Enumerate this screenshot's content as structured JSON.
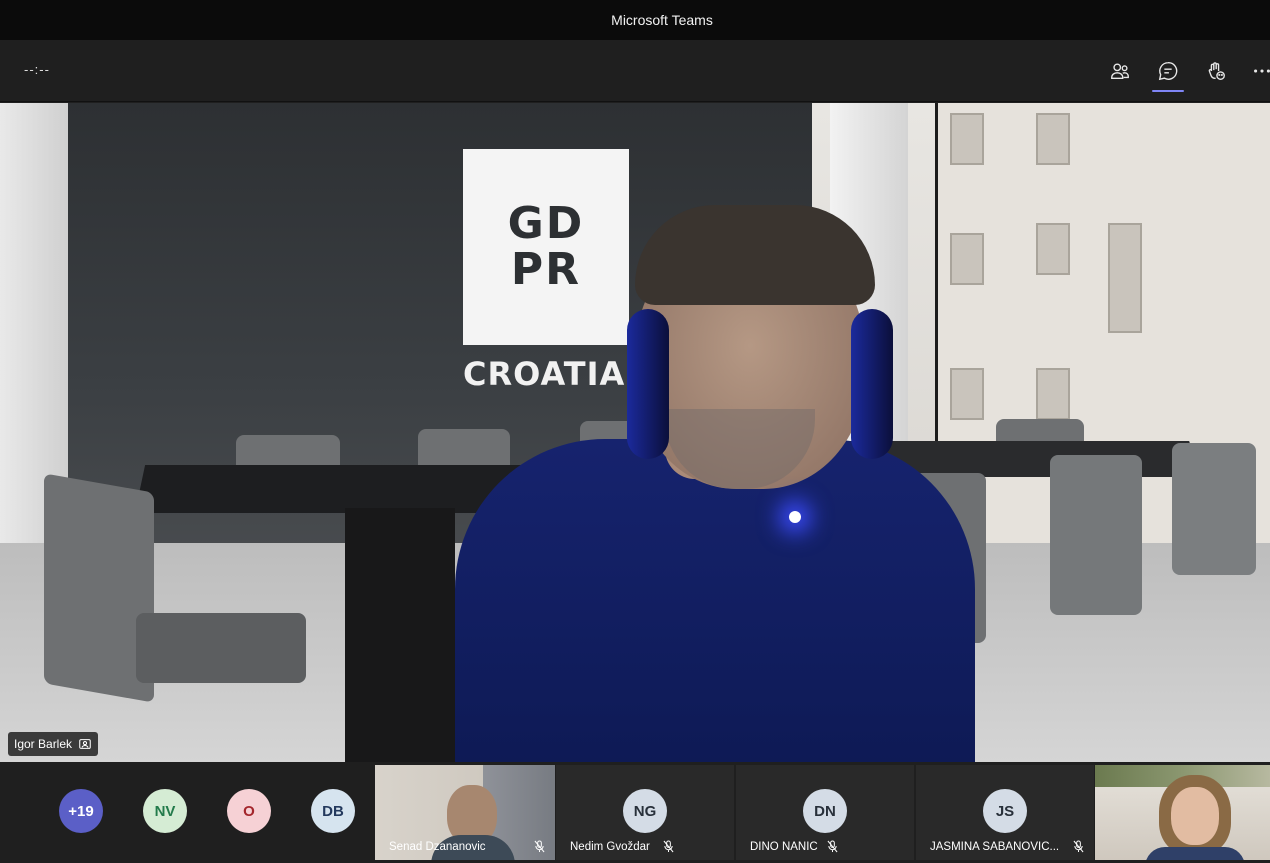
{
  "app": {
    "title": "Microsoft Teams"
  },
  "toolbar": {
    "timer": "--:--",
    "buttons": [
      {
        "name": "participants",
        "icon": "people-icon"
      },
      {
        "name": "chat",
        "icon": "chat-icon",
        "active": true
      },
      {
        "name": "reactions",
        "icon": "raise-hand-icon"
      },
      {
        "name": "more",
        "icon": "more-icon"
      }
    ]
  },
  "main_video": {
    "speaker_name": "Igor Barlek",
    "background_logo": {
      "line1": "GD",
      "line2": "PR",
      "sub": "CROATIA"
    }
  },
  "strip": {
    "overflow": {
      "label": "+19"
    },
    "bubbles": [
      {
        "initials": "NV",
        "bg": "#d5ecd4",
        "fg": "#237b4b"
      },
      {
        "initials": "O",
        "bg": "#f6d1d5",
        "fg": "#a4262c"
      },
      {
        "initials": "DB",
        "bg": "#d6e4ef",
        "fg": "#243a5e"
      }
    ],
    "tiles": [
      {
        "name": "Senad Dzananovic",
        "type": "video",
        "muted": true
      },
      {
        "name": "Nedim Gvoždar",
        "initials": "NG",
        "muted": true
      },
      {
        "name": "DINO NANIC",
        "initials": "DN",
        "muted": true
      },
      {
        "name": "JASMINA SABANOVIC...",
        "initials": "JS",
        "muted": true
      },
      {
        "name": "",
        "type": "video",
        "muted": false
      }
    ]
  },
  "colors": {
    "accent": "#7f85f5",
    "overflow_bubble": "#5b5fc7",
    "background": "#1f1f1f"
  }
}
